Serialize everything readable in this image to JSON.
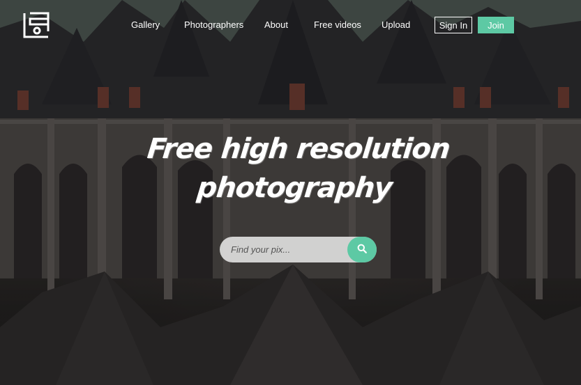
{
  "header": {
    "logo_icon": "photo-stack-logo-icon",
    "nav": [
      {
        "label": "Gallery"
      },
      {
        "label": "Photographers"
      },
      {
        "label": "About"
      },
      {
        "label": "Free videos"
      },
      {
        "label": "Upload"
      }
    ],
    "sign_in_label": "Sign In",
    "join_label": "Join"
  },
  "hero": {
    "headline_line1": "Free high resolution",
    "headline_line2": "photography",
    "background": "gothic-cathedral-photo"
  },
  "search": {
    "placeholder": "Find your pix...",
    "value": "",
    "icon": "search-icon"
  },
  "colors": {
    "accent": "#5dc9a4",
    "text": "#ffffff"
  }
}
